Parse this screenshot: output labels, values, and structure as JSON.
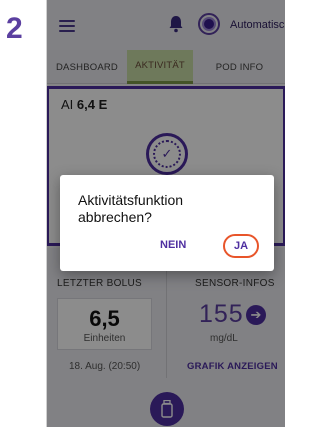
{
  "step": "2",
  "header": {
    "mode_label": "Automatisch",
    "icons": [
      "menu-icon",
      "bell-icon",
      "automated-mode-icon"
    ]
  },
  "tabs": [
    {
      "label": "DASHBOARD"
    },
    {
      "label": "AKTIVITÄT",
      "active": true
    },
    {
      "label": "POD INFO"
    }
  ],
  "activity": {
    "ai_label": "AI",
    "ai_value": "6,4 E"
  },
  "last_bolus": {
    "label": "LETZTER BOLUS",
    "value": "6,5",
    "unit": "Einheiten",
    "time": "18. Aug. (20:50)"
  },
  "sensor": {
    "label": "SENSOR-INFOS",
    "value": "155",
    "unit": "mg/dL",
    "trend_icon": "arrow-right-icon",
    "graph_link": "GRAFIK ANZEIGEN"
  },
  "dialog": {
    "title": "Aktivitätsfunktion abbrechen?",
    "no_label": "NEIN",
    "yes_label": "JA"
  },
  "colors": {
    "accent": "#4e2fa0",
    "active_tab": "#c8dca6",
    "highlight_ring": "#e8552a"
  }
}
